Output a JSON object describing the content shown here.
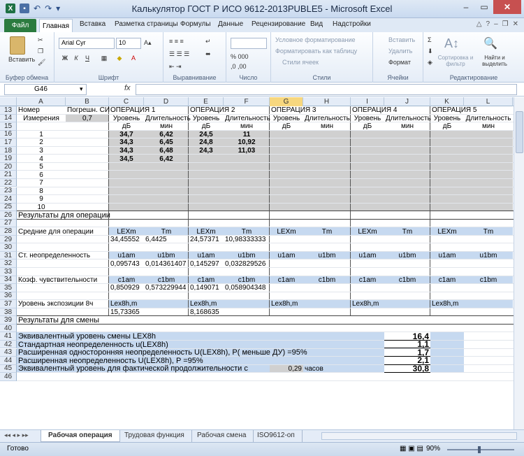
{
  "window": {
    "title": "Калькулятор ГОСТ Р ИСО 9612-2013PUBLE5 - Microsoft Excel"
  },
  "tabs": [
    "Главная",
    "Вставка",
    "Разметка страницы",
    "Формулы",
    "Данные",
    "Рецензирование",
    "Вид",
    "Надстройки"
  ],
  "file_tab": "Файл",
  "ribbon": {
    "clipboard_group": "Буфер обмена",
    "paste_label": "Вставить",
    "font_group": "Шрифт",
    "font_name": "Arial Cyr",
    "font_size": "10",
    "align_group": "Выравнивание",
    "number_group": "Число",
    "styles_group": "Стили",
    "cond_format": "Условное форматирование",
    "format_table": "Форматировать как таблицу",
    "cell_styles": "Стили ячеек",
    "cells_group": "Ячейки",
    "insert": "Вставить",
    "delete": "Удалить",
    "format": "Формат",
    "editing_group": "Редактирование",
    "sort_filter": "Сортировка и фильтр",
    "find_select": "Найти и выделить"
  },
  "formula_bar": {
    "name_box": "G46",
    "fx": "fx",
    "value": ""
  },
  "columns": [
    "A",
    "B",
    "C",
    "D",
    "E",
    "F",
    "G",
    "H",
    "I",
    "J",
    "K",
    "L"
  ],
  "selected_column": "G",
  "rows": [
    {
      "n": "13",
      "cells": [
        {
          "col": "A",
          "text": "Номер"
        },
        {
          "col": "B",
          "text": "Погрешн. СИ"
        },
        {
          "col": "C",
          "text": "ОПЕРАЦИЯ 1"
        },
        {
          "col": "E",
          "text": "ОПЕРАЦИЯ 2"
        },
        {
          "col": "G",
          "text": "ОПЕРАЦИЯ 3"
        },
        {
          "col": "I",
          "text": "ОПЕРАЦИЯ 4"
        },
        {
          "col": "K",
          "text": "ОПЕРАЦИЯ 5"
        }
      ]
    },
    {
      "n": "14",
      "cells": [
        {
          "col": "A",
          "text": "Измерения"
        },
        {
          "col": "B",
          "text": "0,7"
        },
        {
          "col": "C",
          "text": "Уровень"
        },
        {
          "col": "D",
          "text": "Длительность"
        },
        {
          "col": "E",
          "text": "Уровень"
        },
        {
          "col": "F",
          "text": "Длительность"
        },
        {
          "col": "G",
          "text": "Уровень"
        },
        {
          "col": "H",
          "text": "Длительность"
        },
        {
          "col": "I",
          "text": "Уровень"
        },
        {
          "col": "J",
          "text": "Длительность"
        },
        {
          "col": "K",
          "text": "Уровень"
        },
        {
          "col": "L",
          "text": "Длительность"
        }
      ]
    },
    {
      "n": "15",
      "cells": [
        {
          "col": "C",
          "text": "дБ"
        },
        {
          "col": "D",
          "text": "мин"
        },
        {
          "col": "E",
          "text": "дБ"
        },
        {
          "col": "F",
          "text": "мин"
        },
        {
          "col": "G",
          "text": "дБ"
        },
        {
          "col": "H",
          "text": "мин"
        },
        {
          "col": "I",
          "text": "дБ"
        },
        {
          "col": "J",
          "text": "мин"
        },
        {
          "col": "K",
          "text": "дБ"
        },
        {
          "col": "L",
          "text": "мин"
        }
      ]
    },
    {
      "n": "16",
      "cells": [
        {
          "col": "A",
          "text": "1"
        },
        {
          "col": "C",
          "text": "34,7"
        },
        {
          "col": "D",
          "text": "6,42"
        },
        {
          "col": "E",
          "text": "24,5"
        },
        {
          "col": "F",
          "text": "11"
        }
      ]
    },
    {
      "n": "17",
      "cells": [
        {
          "col": "A",
          "text": "2"
        },
        {
          "col": "C",
          "text": "34,3"
        },
        {
          "col": "D",
          "text": "6,45"
        },
        {
          "col": "E",
          "text": "24,8"
        },
        {
          "col": "F",
          "text": "10,92"
        }
      ]
    },
    {
      "n": "18",
      "cells": [
        {
          "col": "A",
          "text": "3"
        },
        {
          "col": "C",
          "text": "34,3"
        },
        {
          "col": "D",
          "text": "6,48"
        },
        {
          "col": "E",
          "text": "24,3"
        },
        {
          "col": "F",
          "text": "11,03"
        }
      ]
    },
    {
      "n": "19",
      "cells": [
        {
          "col": "A",
          "text": "4"
        },
        {
          "col": "C",
          "text": "34,5"
        },
        {
          "col": "D",
          "text": "6,42"
        }
      ]
    },
    {
      "n": "20",
      "cells": [
        {
          "col": "A",
          "text": "5"
        }
      ]
    },
    {
      "n": "21",
      "cells": [
        {
          "col": "A",
          "text": "6"
        }
      ]
    },
    {
      "n": "22",
      "cells": [
        {
          "col": "A",
          "text": "7"
        }
      ]
    },
    {
      "n": "23",
      "cells": [
        {
          "col": "A",
          "text": "8"
        }
      ]
    },
    {
      "n": "24",
      "cells": [
        {
          "col": "A",
          "text": "9"
        }
      ]
    },
    {
      "n": "25",
      "cells": [
        {
          "col": "A",
          "text": "10"
        }
      ]
    },
    {
      "n": "26",
      "cells": [
        {
          "col": "A",
          "text": "Результаты для операции"
        }
      ]
    },
    {
      "n": "27",
      "cells": []
    },
    {
      "n": "28",
      "cells": [
        {
          "col": "A",
          "text": "Средние для операции"
        },
        {
          "col": "C",
          "text": "LEXm"
        },
        {
          "col": "D",
          "text": "Tm"
        },
        {
          "col": "E",
          "text": "LEXm"
        },
        {
          "col": "F",
          "text": "Tm"
        },
        {
          "col": "G",
          "text": "LEXm"
        },
        {
          "col": "H",
          "text": "Tm"
        },
        {
          "col": "I",
          "text": "LEXm"
        },
        {
          "col": "J",
          "text": "Tm"
        },
        {
          "col": "K",
          "text": "LEXm"
        },
        {
          "col": "L",
          "text": "Tm"
        }
      ]
    },
    {
      "n": "29",
      "cells": [
        {
          "col": "C",
          "text": "34,45552"
        },
        {
          "col": "D",
          "text": "6,4425"
        },
        {
          "col": "E",
          "text": "24,57371"
        },
        {
          "col": "F",
          "text": "10,98333333"
        }
      ]
    },
    {
      "n": "30",
      "cells": []
    },
    {
      "n": "31",
      "cells": [
        {
          "col": "A",
          "text": "Ст. неопределенность"
        },
        {
          "col": "C",
          "text": "u1am"
        },
        {
          "col": "D",
          "text": "u1bm"
        },
        {
          "col": "E",
          "text": "u1am"
        },
        {
          "col": "F",
          "text": "u1bm"
        },
        {
          "col": "G",
          "text": "u1am"
        },
        {
          "col": "H",
          "text": "u1bm"
        },
        {
          "col": "I",
          "text": "u1am"
        },
        {
          "col": "J",
          "text": "u1bm"
        },
        {
          "col": "K",
          "text": "u1am"
        },
        {
          "col": "L",
          "text": "u1bm"
        }
      ]
    },
    {
      "n": "32",
      "cells": [
        {
          "col": "C",
          "text": "0,095743"
        },
        {
          "col": "D",
          "text": "0,014361407"
        },
        {
          "col": "E",
          "text": "0,145297"
        },
        {
          "col": "F",
          "text": "0,032829526"
        }
      ]
    },
    {
      "n": "33",
      "cells": []
    },
    {
      "n": "34",
      "cells": [
        {
          "col": "A",
          "text": "Коэф. чувствительности"
        },
        {
          "col": "C",
          "text": "c1am"
        },
        {
          "col": "D",
          "text": "c1bm"
        },
        {
          "col": "E",
          "text": "c1am"
        },
        {
          "col": "F",
          "text": "c1bm"
        },
        {
          "col": "G",
          "text": "c1am"
        },
        {
          "col": "H",
          "text": "c1bm"
        },
        {
          "col": "I",
          "text": "c1am"
        },
        {
          "col": "J",
          "text": "c1bm"
        },
        {
          "col": "K",
          "text": "c1am"
        },
        {
          "col": "L",
          "text": "c1bm"
        }
      ]
    },
    {
      "n": "35",
      "cells": [
        {
          "col": "C",
          "text": "0,850929"
        },
        {
          "col": "D",
          "text": "0,573229944"
        },
        {
          "col": "E",
          "text": "0,149071"
        },
        {
          "col": "F",
          "text": "0,058904348"
        }
      ]
    },
    {
      "n": "36",
      "cells": []
    },
    {
      "n": "37",
      "cells": [
        {
          "col": "A",
          "text": "Уровень экспозиции 8ч"
        },
        {
          "col": "C",
          "text": "Lex8h,m"
        },
        {
          "col": "E",
          "text": "Lex8h,m"
        },
        {
          "col": "G",
          "text": "Lex8h,m"
        },
        {
          "col": "I",
          "text": "Lex8h,m"
        },
        {
          "col": "K",
          "text": "Lex8h,m"
        }
      ]
    },
    {
      "n": "38",
      "cells": [
        {
          "col": "C",
          "text": "15,73365"
        },
        {
          "col": "E",
          "text": "8,168635"
        }
      ]
    },
    {
      "n": "39",
      "cells": [
        {
          "col": "A",
          "text": "Результаты для смены"
        }
      ]
    },
    {
      "n": "40",
      "cells": []
    },
    {
      "n": "41",
      "cells": [
        {
          "col": "A",
          "text": "Эквивалентный уровень смены LEX8h"
        },
        {
          "col": "J",
          "text": "16,4"
        }
      ]
    },
    {
      "n": "42",
      "cells": [
        {
          "col": "A",
          "text": "Стандартная неопределенность u(LEX8h)"
        },
        {
          "col": "J",
          "text": "1,1"
        }
      ]
    },
    {
      "n": "43",
      "cells": [
        {
          "col": "A",
          "text": "Расширенная односторонняя неопределенность  U(LEX8h), P( меньше ДУ) =95%"
        },
        {
          "col": "J",
          "text": "1,7"
        }
      ]
    },
    {
      "n": "44",
      "cells": [
        {
          "col": "A",
          "text": "Расширенная неопределенность  U(LEX8h), P =95%"
        },
        {
          "col": "J",
          "text": "2,1"
        }
      ]
    },
    {
      "n": "45",
      "cells": [
        {
          "col": "A",
          "text": "Эквивалентный уровень для фактической продолжительности с"
        },
        {
          "col": "G",
          "text": "0,29"
        },
        {
          "col": "H",
          "text": "часов"
        },
        {
          "col": "J",
          "text": "30,8"
        }
      ]
    },
    {
      "n": "46",
      "cells": []
    }
  ],
  "sheets": [
    "Рабочая операция",
    "Трудовая функция",
    "Рабочая смена",
    "ISO9612-оп"
  ],
  "active_sheet": "Рабочая операция",
  "status": {
    "ready": "Готово",
    "zoom": "90%"
  }
}
